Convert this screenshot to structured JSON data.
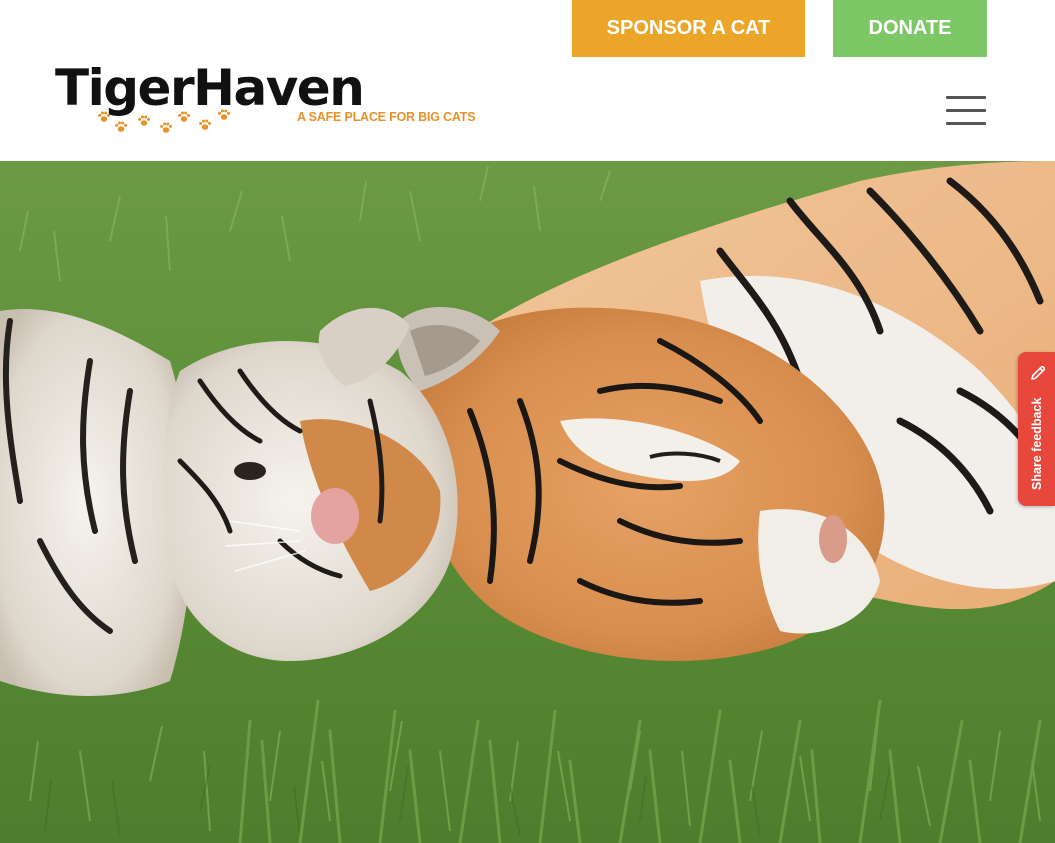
{
  "header": {
    "logo": {
      "name": "TigerHaven",
      "tagline": "A SAFE PLACE FOR BIG CATS"
    },
    "buttons": {
      "sponsor_label": "SPONSOR A CAT",
      "donate_label": "DONATE"
    },
    "menu_icon": "hamburger-menu-icon"
  },
  "hero": {
    "image_subject": "two tigers resting heads together on green grass"
  },
  "feedback": {
    "label": "Share feedback",
    "icon": "pencil-icon"
  },
  "colors": {
    "sponsor_button": "#eba62a",
    "donate_button": "#7ec766",
    "logo_text": "#111111",
    "tagline": "#e8912a",
    "feedback_tab": "#e8483c",
    "grass": "#5a8f3a"
  }
}
